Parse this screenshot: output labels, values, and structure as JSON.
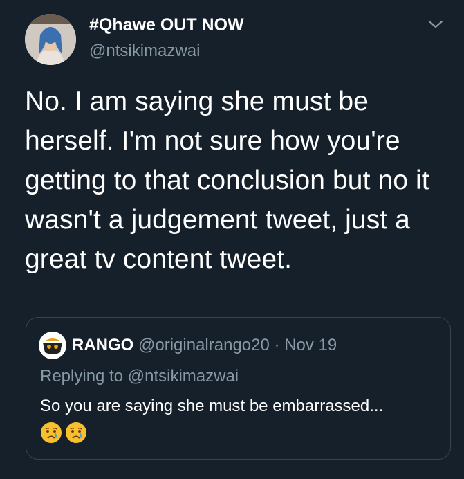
{
  "tweet": {
    "display_name": "#Qhawe OUT NOW",
    "handle": "@ntsikimazwai",
    "text": "No. I am saying she must be herself. I'm not sure how you're getting to that conclusion but no it wasn't a judgement tweet, just a great tv content tweet.",
    "menu_icon": "chevron-down-icon"
  },
  "quoted": {
    "name": "RANGO",
    "handle": "@originalrango20",
    "separator": "·",
    "date": "Nov 19",
    "replying_to": "Replying to @ntsikimazwai",
    "text": "So you are saying she must be embarrassed...",
    "emojis": [
      "crying-face",
      "crying-face"
    ]
  },
  "colors": {
    "background": "#15202b",
    "secondary_text": "#8899a6",
    "border": "#38444d",
    "primary_text": "#ffffff"
  }
}
